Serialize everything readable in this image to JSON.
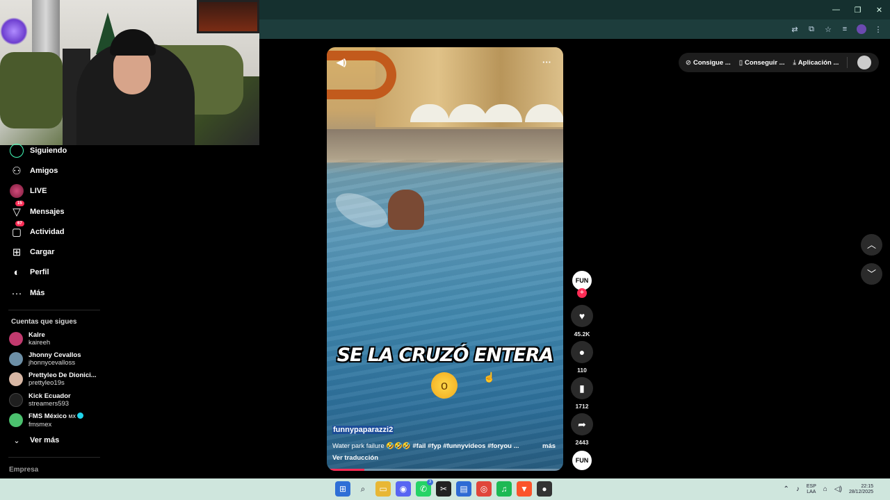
{
  "window": {
    "minimize_glyph": "—",
    "restore_glyph": "❐",
    "close_glyph": "✕",
    "toolbar_icons": [
      "translate-icon",
      "install-icon",
      "bookmark-star-icon",
      "media-icon",
      "profile-icon",
      "menu-icon"
    ]
  },
  "sidebar": {
    "nav": [
      {
        "label": "Siguiendo",
        "icon": "following-icon"
      },
      {
        "label": "Amigos",
        "icon": "friends-icon"
      },
      {
        "label": "LIVE",
        "icon": "live-icon"
      },
      {
        "label": "Mensajes",
        "icon": "messages-icon",
        "badge": "15"
      },
      {
        "label": "Actividad",
        "icon": "activity-icon",
        "badge": "67"
      },
      {
        "label": "Cargar",
        "icon": "upload-icon"
      },
      {
        "label": "Perfil",
        "icon": "profile-icon"
      },
      {
        "label": "Más",
        "icon": "more-icon"
      }
    ],
    "following_title": "Cuentas que sigues",
    "accounts": [
      {
        "name": "Kalre",
        "username": "kaireeh",
        "avatar_color": "#c13a6e"
      },
      {
        "name": "Jhonny Cevallos",
        "username": "jhonnycevalloss",
        "avatar_color": "#6c8fa6"
      },
      {
        "name": "Prettyleo De Dionici...",
        "username": "prettyleo19s",
        "avatar_color": "#d8b7a4"
      },
      {
        "name": "Kick Ecuador",
        "username": "streamers593",
        "avatar_color": "#1f1f1f"
      },
      {
        "name": "FMS México",
        "name_suffix": "MX",
        "username": "fmsmex",
        "avatar_color": "#4bc16e",
        "verified": true
      }
    ],
    "see_more": "Ver más",
    "company": "Empresa"
  },
  "video": {
    "caption": "SE LA CRUZÓ ENTERA",
    "emoji": "😲",
    "author": "funnypaparazzi2",
    "description": "Water park failure 🤣🤣🤣",
    "hashtags": "#fail #fyp #funnyvideos #foryou ...",
    "more": "más",
    "translate": "Ver traducción",
    "progress": 0.16
  },
  "actions": {
    "creator_avatar_text": "FUN",
    "likes": "45.2K",
    "comments": "110",
    "saves": "1712",
    "shares": "2443"
  },
  "topbar": {
    "coins": "Consigue ...",
    "app_short": "Conseguir ...",
    "app": "Aplicación ..."
  },
  "taskbar": {
    "apps": [
      {
        "name": "windows-start-icon",
        "color": "#2f6fd6",
        "glyph": "⊞"
      },
      {
        "name": "search-icon",
        "color": "#cfe6dd",
        "glyph": "⌕"
      },
      {
        "name": "file-explorer-icon",
        "color": "#e8b735",
        "glyph": "▭"
      },
      {
        "name": "discord-icon",
        "color": "#5865f2",
        "glyph": "◉"
      },
      {
        "name": "whatsapp-icon",
        "color": "#25d366",
        "glyph": "✆",
        "badge": "3"
      },
      {
        "name": "capcut-icon",
        "color": "#222222",
        "glyph": "✂"
      },
      {
        "name": "store-icon",
        "color": "#2e6bd4",
        "glyph": "▤"
      },
      {
        "name": "chrome-icon",
        "color": "#e0453a",
        "glyph": "◎"
      },
      {
        "name": "spotify-icon",
        "color": "#1db954",
        "glyph": "♫"
      },
      {
        "name": "brave-icon",
        "color": "#fb542b",
        "glyph": "▼"
      },
      {
        "name": "obs-icon",
        "color": "#333333",
        "glyph": "●"
      }
    ],
    "lang_line1": "ESP",
    "lang_line2": "LAA",
    "time": "22:15",
    "date": "28/12/2025"
  }
}
